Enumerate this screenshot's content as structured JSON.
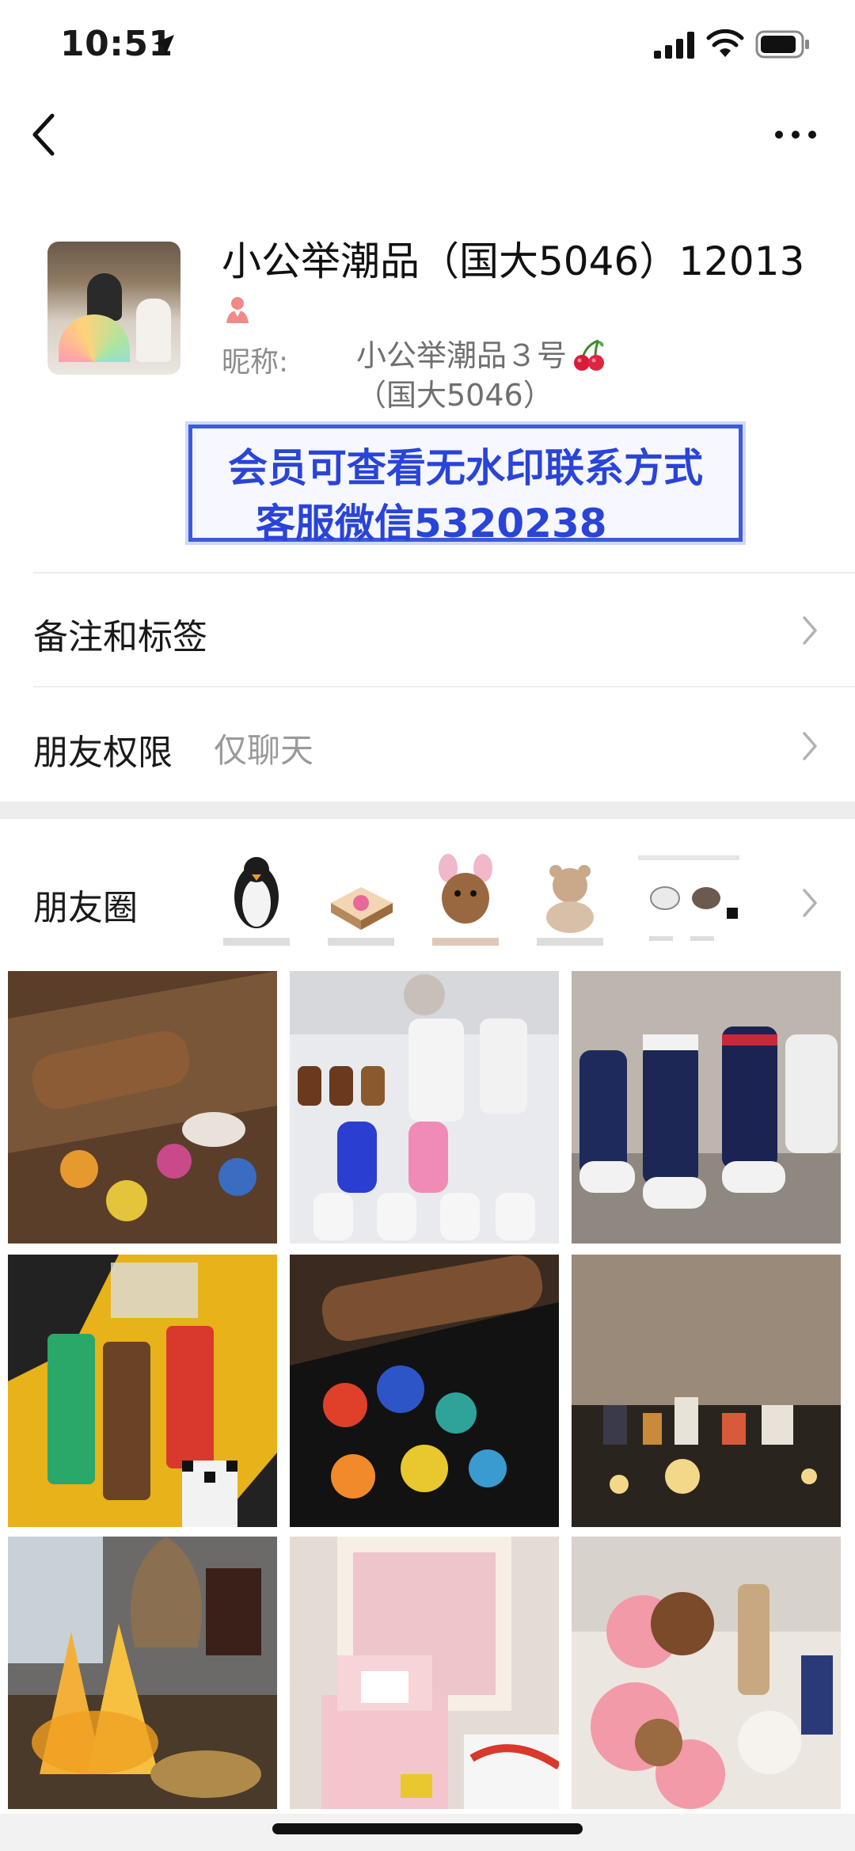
{
  "status_bar": {
    "time": "10:51"
  },
  "profile": {
    "name": "小公举潮品（国大5046）12013",
    "nickname_label": "昵称:",
    "nickname_line1": "小公举潮品３号",
    "nickname_line2": "（国大5046）"
  },
  "banner": {
    "line1": "会员可查看无水印联系方式",
    "line2": "客服微信5320238"
  },
  "rows": {
    "notes_tags": "备注和标签",
    "friend_permission": "朋友权限",
    "friend_permission_value": "仅聊天",
    "moments": "朋友圈"
  },
  "colors": {
    "banner_blue": "#2a44d8",
    "separator_gray": "#ededed"
  }
}
